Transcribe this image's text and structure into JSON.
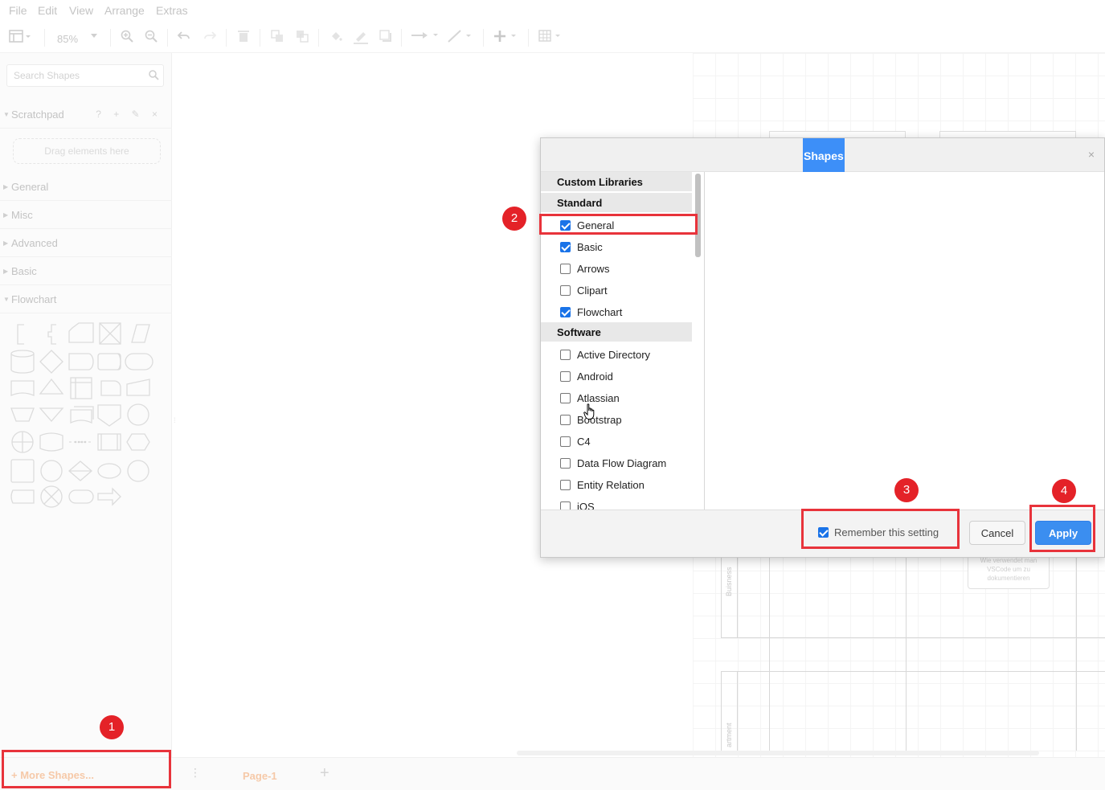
{
  "menu": [
    "File",
    "Edit",
    "View",
    "Arrange",
    "Extras"
  ],
  "toolbar": {
    "zoom": "85%"
  },
  "sidebar": {
    "search_placeholder": "Search Shapes",
    "scratchpad": {
      "title": "Scratchpad",
      "tools": "? + ✎ ×",
      "drop_hint": "Drag elements here"
    },
    "sections": [
      "General",
      "Misc",
      "Advanced",
      "Basic",
      "Flowchart"
    ],
    "more_shapes": "+ More Shapes..."
  },
  "pages": {
    "current": "Page-1",
    "add": "+",
    "menu": "⋮"
  },
  "canvas": {
    "lane_label_1": "Buisness",
    "lane_label_2": "artment",
    "note_text": "Wie verwendet man VSCode um zu dokumentieren"
  },
  "dialog": {
    "title": "Shapes",
    "close": "×",
    "categories": {
      "custom": "Custom Libraries",
      "standard": "Standard",
      "software": "Software"
    },
    "standard_items": [
      {
        "label": "General",
        "checked": true
      },
      {
        "label": "Basic",
        "checked": true
      },
      {
        "label": "Arrows",
        "checked": false
      },
      {
        "label": "Clipart",
        "checked": false
      },
      {
        "label": "Flowchart",
        "checked": true
      }
    ],
    "software_items": [
      {
        "label": "Active Directory",
        "checked": false
      },
      {
        "label": "Android",
        "checked": false
      },
      {
        "label": "Atlassian",
        "checked": false
      },
      {
        "label": "Bootstrap",
        "checked": false
      },
      {
        "label": "C4",
        "checked": false
      },
      {
        "label": "Data Flow Diagram",
        "checked": false
      },
      {
        "label": "Entity Relation",
        "checked": false
      },
      {
        "label": "iOS",
        "checked": false
      }
    ],
    "remember_label": "Remember this setting",
    "remember_checked": true,
    "cancel": "Cancel",
    "apply": "Apply"
  },
  "annotations": [
    "1",
    "2",
    "3",
    "4"
  ],
  "colors": {
    "accent": "#3b8ef0",
    "highlight": "#e8333b",
    "badge": "#e42228"
  }
}
